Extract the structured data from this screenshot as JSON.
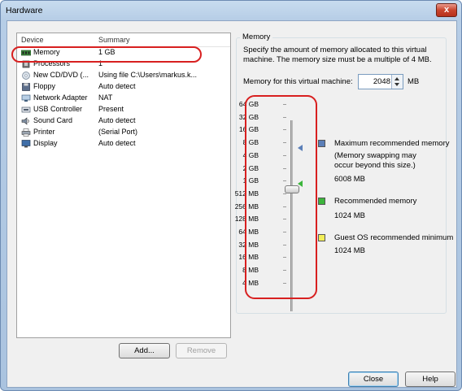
{
  "window": {
    "title": "Hardware",
    "close_glyph": "x"
  },
  "device_list": {
    "headers": {
      "device": "Device",
      "summary": "Summary"
    },
    "rows": [
      {
        "name": "Memory",
        "summary": "1 GB",
        "icon": "memory-icon"
      },
      {
        "name": "Processors",
        "summary": "1",
        "icon": "processor-icon"
      },
      {
        "name": "New CD/DVD (...",
        "summary": "Using file C:\\Users\\markus.k...",
        "icon": "cd-dvd-icon"
      },
      {
        "name": "Floppy",
        "summary": "Auto detect",
        "icon": "floppy-icon"
      },
      {
        "name": "Network Adapter",
        "summary": "NAT",
        "icon": "network-adapter-icon"
      },
      {
        "name": "USB Controller",
        "summary": "Present",
        "icon": "usb-icon"
      },
      {
        "name": "Sound Card",
        "summary": "Auto detect",
        "icon": "sound-card-icon"
      },
      {
        "name": "Printer",
        "summary": "(Serial Port)",
        "icon": "printer-icon"
      },
      {
        "name": "Display",
        "summary": "Auto detect",
        "icon": "display-icon"
      }
    ],
    "add_label": "Add...",
    "remove_label": "Remove"
  },
  "memory": {
    "group_title": "Memory",
    "description": "Specify the amount of memory allocated to this virtual machine. The memory size must be a multiple of 4 MB.",
    "field_label": "Memory for this virtual machine:",
    "value": "2048",
    "unit": "MB",
    "scale": [
      "64 GB",
      "32 GB",
      "16 GB",
      "8 GB",
      "4 GB",
      "2 GB",
      "1 GB",
      "512 MB",
      "256 MB",
      "128 MB",
      "64 MB",
      "32 MB",
      "16 MB",
      "8 MB",
      "4 MB"
    ],
    "legend": {
      "max_title": "Maximum recommended memory",
      "max_note": "(Memory swapping may occur beyond this size.)",
      "max_value": "6008 MB",
      "rec_title": "Recommended memory",
      "rec_value": "1024 MB",
      "guest_title": "Guest OS recommended minimum",
      "guest_value": "1024 MB"
    },
    "colors": {
      "max": "#5b7fb8",
      "rec": "#3cb53c",
      "guest": "#f2ee58"
    }
  },
  "footer": {
    "close_label": "Close",
    "help_label": "Help"
  }
}
